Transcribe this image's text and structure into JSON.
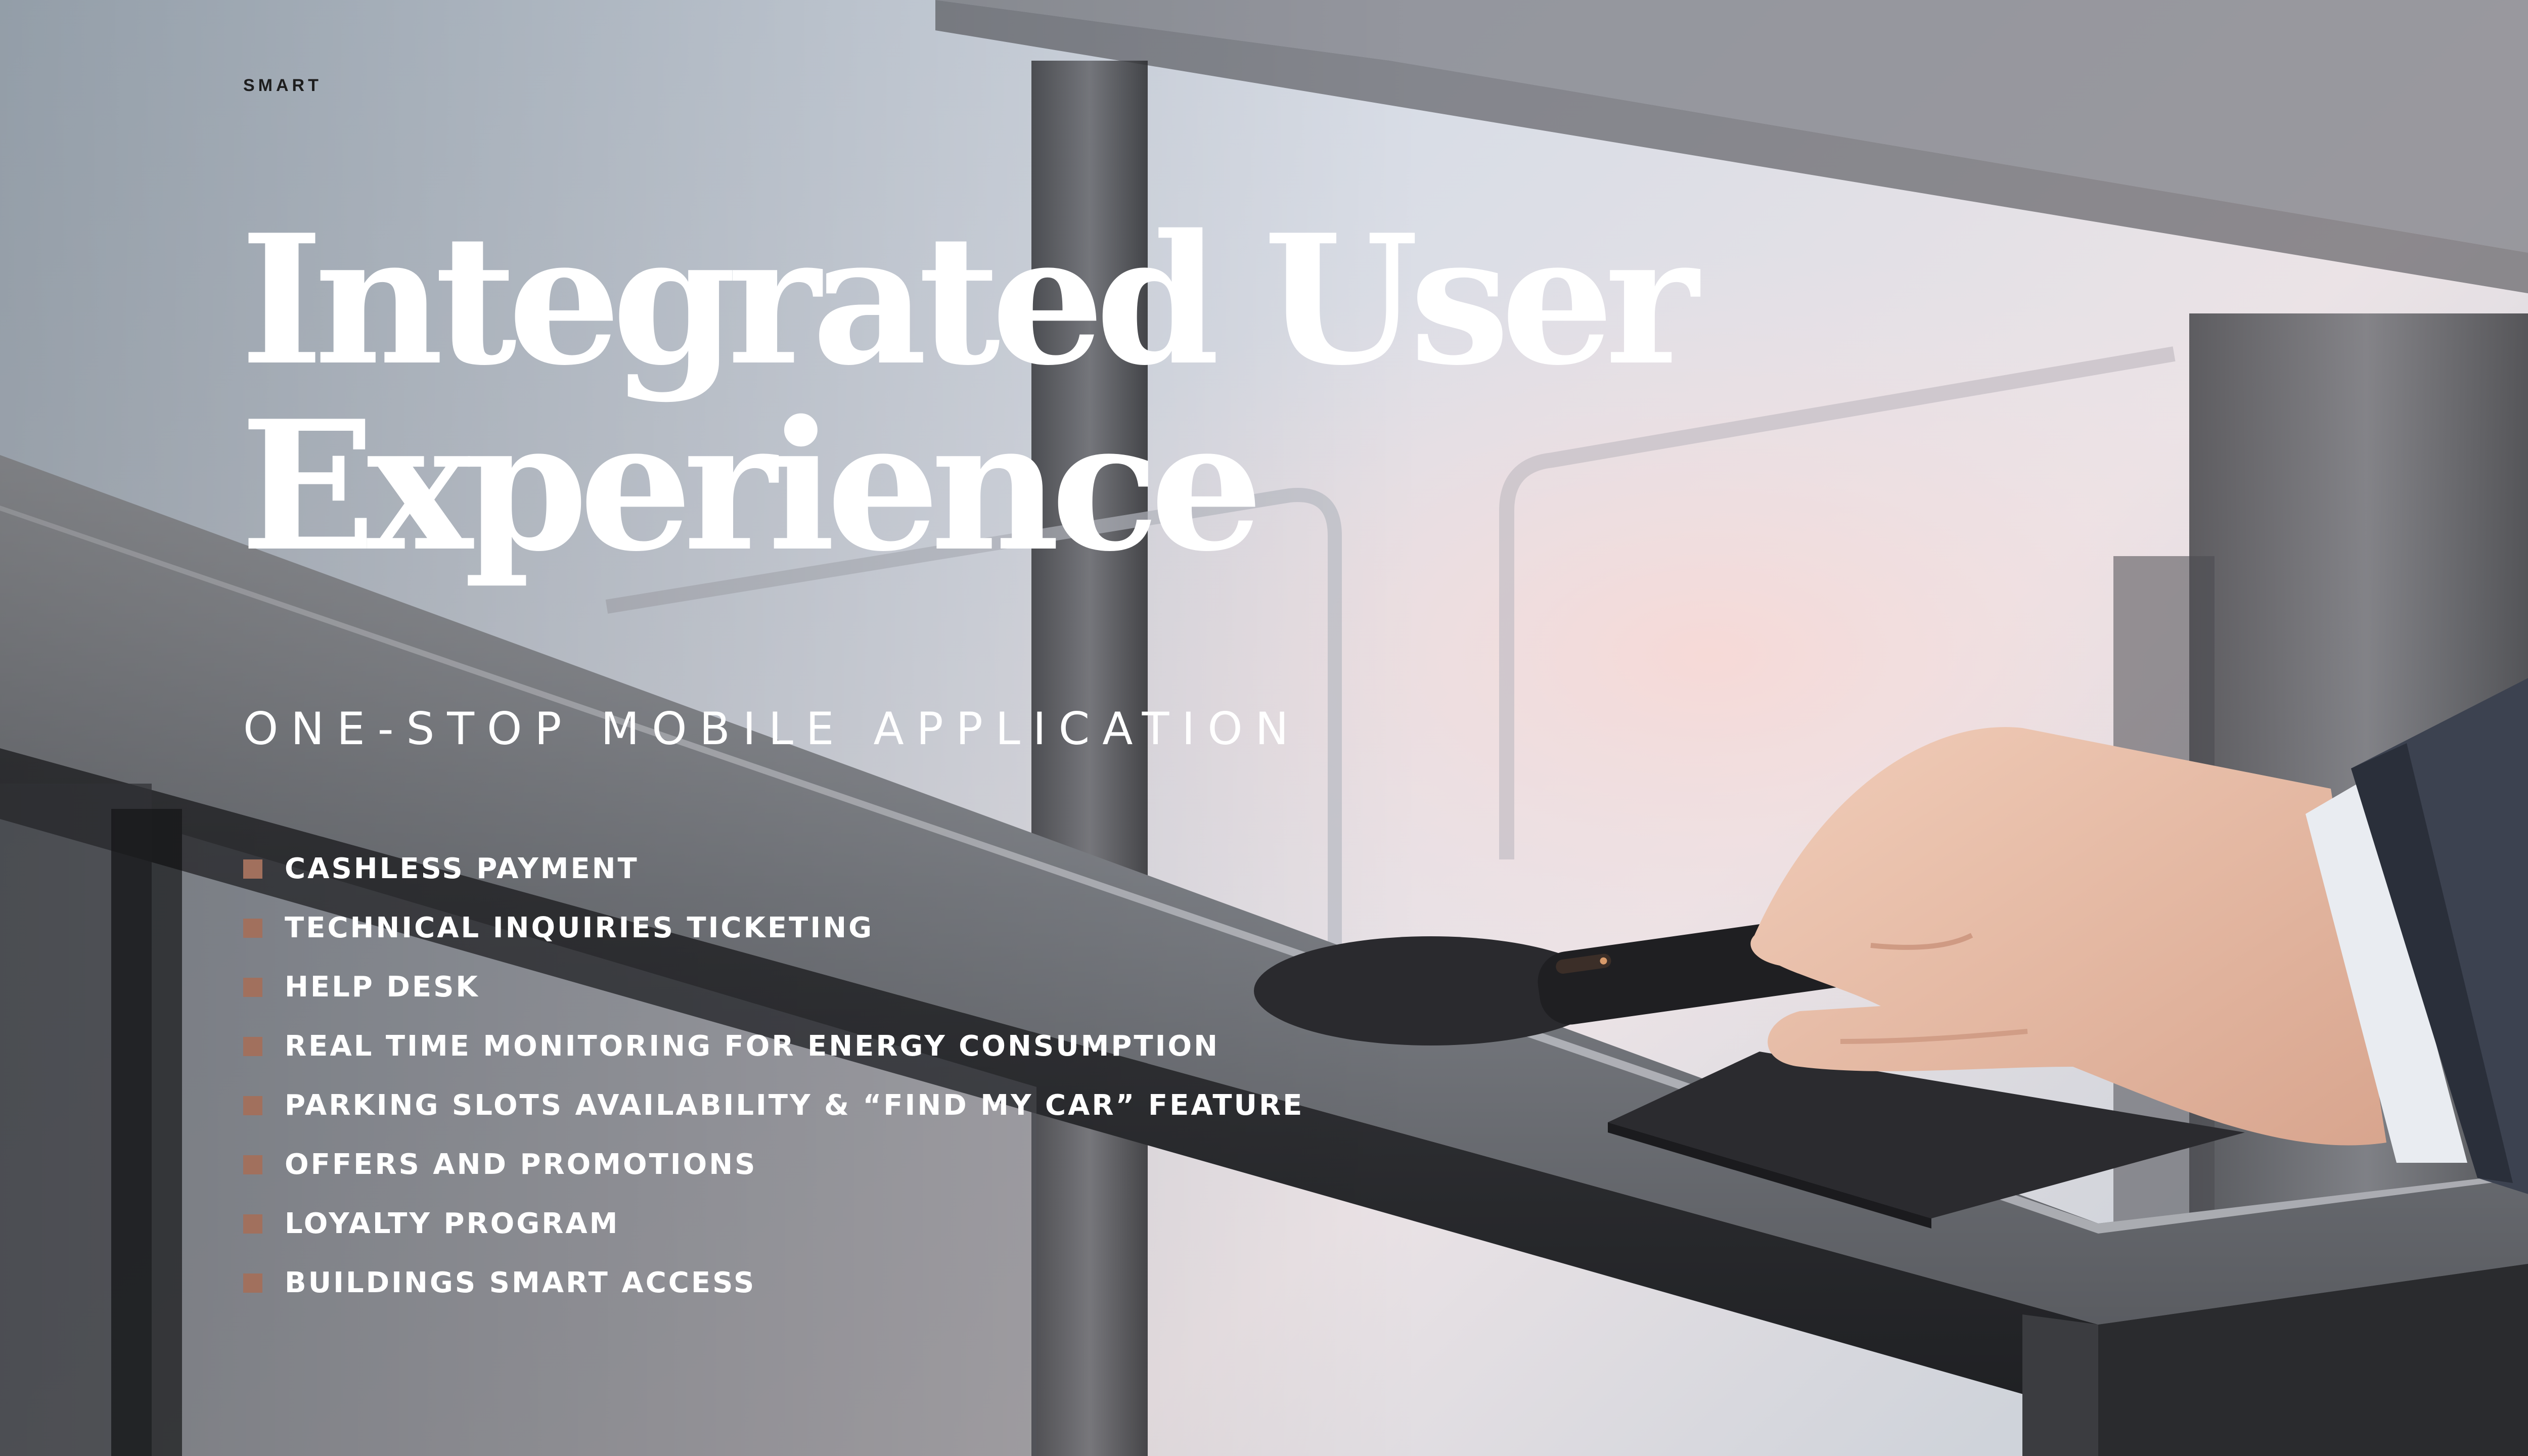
{
  "brand_colors": {
    "bullet": "#a1705d",
    "text_light": "#ffffff",
    "text_dark": "#1d1d1d"
  },
  "eyebrow": "SMART",
  "headline": {
    "line1": "Integrated User",
    "line2": "Experience"
  },
  "subtitle": "ONE-STOP MOBILE APPLICATION",
  "features": [
    "CASHLESS PAYMENT",
    "TECHNICAL INQUIRIES TICKETING",
    "HELP DESK",
    "REAL TIME MONITORING FOR ENERGY CONSUMPTION",
    "PARKING SLOTS AVAILABILITY & “FIND MY CAR” FEATURE",
    "OFFERS AND PROMOTIONS",
    "LOYALTY PROGRAM",
    "BUILDINGS SMART ACCESS"
  ]
}
